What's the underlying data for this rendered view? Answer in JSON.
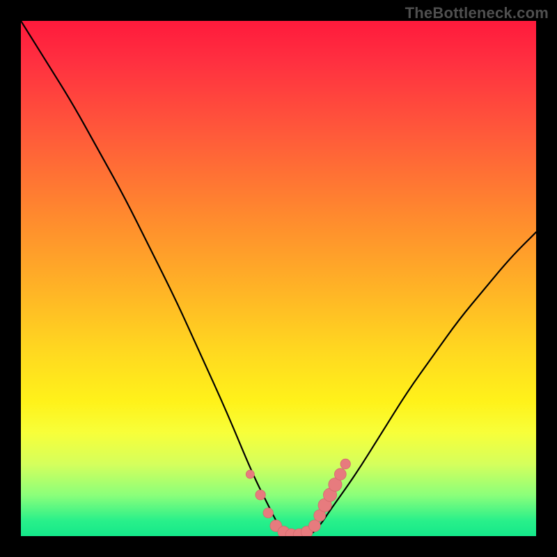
{
  "watermark": {
    "text": "TheBottleneck.com"
  },
  "colors": {
    "curve_stroke": "#000000",
    "marker_fill": "#e77b7e",
    "marker_stroke": "#d46a6d",
    "green_bottom": "#14e88a"
  },
  "chart_data": {
    "type": "line",
    "title": "",
    "xlabel": "",
    "ylabel": "",
    "xlim": [
      0,
      100
    ],
    "ylim": [
      0,
      100
    ],
    "series": [
      {
        "name": "bottleneck-curve",
        "x": [
          0,
          5,
          10,
          15,
          20,
          25,
          30,
          35,
          40,
          45,
          48,
          50,
          52,
          54,
          56,
          58,
          60,
          65,
          70,
          75,
          80,
          85,
          90,
          95,
          100
        ],
        "y": [
          100,
          92,
          84,
          75,
          66,
          56,
          46,
          35,
          24,
          12,
          6,
          2,
          0,
          0,
          0,
          2,
          5,
          12,
          20,
          28,
          35,
          42,
          48,
          54,
          59
        ]
      }
    ],
    "markers": [
      {
        "x": 44.5,
        "y": 12.0,
        "r": 1.0
      },
      {
        "x": 46.5,
        "y": 8.0,
        "r": 1.2
      },
      {
        "x": 48.0,
        "y": 4.5,
        "r": 1.2
      },
      {
        "x": 49.5,
        "y": 2.0,
        "r": 1.4
      },
      {
        "x": 51.0,
        "y": 0.8,
        "r": 1.4
      },
      {
        "x": 52.5,
        "y": 0.3,
        "r": 1.4
      },
      {
        "x": 54.0,
        "y": 0.3,
        "r": 1.4
      },
      {
        "x": 55.5,
        "y": 0.8,
        "r": 1.4
      },
      {
        "x": 57.0,
        "y": 2.0,
        "r": 1.4
      },
      {
        "x": 58.0,
        "y": 4.0,
        "r": 1.4
      },
      {
        "x": 59.0,
        "y": 6.0,
        "r": 1.6
      },
      {
        "x": 60.0,
        "y": 8.0,
        "r": 1.6
      },
      {
        "x": 61.0,
        "y": 10.0,
        "r": 1.6
      },
      {
        "x": 62.0,
        "y": 12.0,
        "r": 1.4
      },
      {
        "x": 63.0,
        "y": 14.0,
        "r": 1.2
      }
    ]
  }
}
